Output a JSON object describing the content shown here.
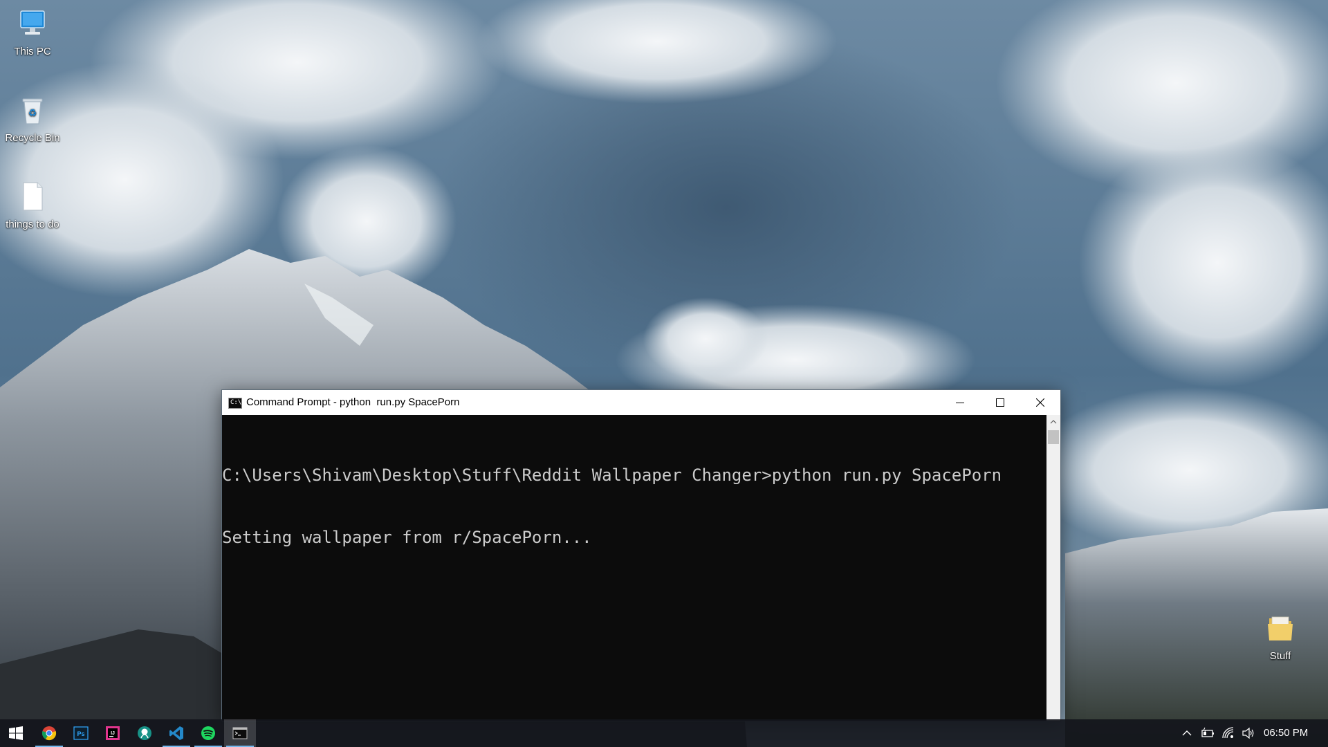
{
  "desktop": {
    "icons": [
      {
        "label": "This PC",
        "icon": "monitor-icon"
      },
      {
        "label": "Recycle Bin",
        "icon": "recycle-bin-icon"
      },
      {
        "label": "things to do",
        "icon": "text-file-icon"
      },
      {
        "label": "Stuff",
        "icon": "folder-icon"
      }
    ]
  },
  "window": {
    "title": "Command Prompt - python  run.py SpacePorn",
    "app_icon_text": "C:\\",
    "console_lines": [
      "C:\\Users\\Shivam\\Desktop\\Stuff\\Reddit Wallpaper Changer>python run.py SpacePorn",
      "Setting wallpaper from r/SpacePorn..."
    ]
  },
  "taskbar": {
    "items": [
      {
        "name": "start-button",
        "icon": "windows-logo-icon"
      },
      {
        "name": "chrome",
        "icon": "chrome-icon",
        "running": true
      },
      {
        "name": "photoshop",
        "icon": "photoshop-icon",
        "label": "Ps"
      },
      {
        "name": "intellij",
        "icon": "intellij-icon",
        "label": "IJ"
      },
      {
        "name": "gitkraken",
        "icon": "gitkraken-icon"
      },
      {
        "name": "vscode",
        "icon": "vscode-icon",
        "running": true
      },
      {
        "name": "spotify",
        "icon": "spotify-icon",
        "running": true
      },
      {
        "name": "command-prompt",
        "icon": "cmd-icon",
        "running": true,
        "active": true
      }
    ],
    "tray": {
      "icons": [
        "chevron-up-icon",
        "battery-icon",
        "wifi-icon",
        "volume-icon"
      ],
      "clock": "06:50 PM"
    }
  },
  "colors": {
    "taskbar_accent": "#76b9ed",
    "console_bg": "#0c0c0c",
    "console_fg": "#cccccc"
  }
}
